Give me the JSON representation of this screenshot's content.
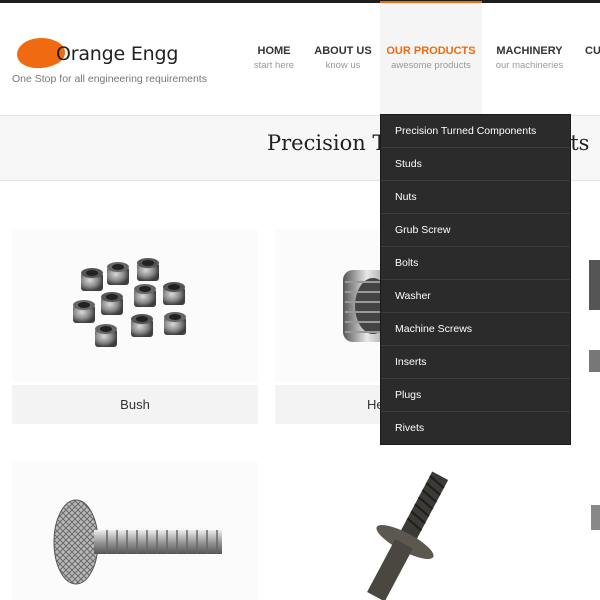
{
  "brand": {
    "name": "Orange Engg",
    "tagline": "One Stop for all engineering requirements",
    "accent": "#ef6a10"
  },
  "nav": [
    {
      "title": "HOME",
      "subtitle": "start here"
    },
    {
      "title": "ABOUT US",
      "subtitle": "know us"
    },
    {
      "title": "OUR PRODUCTS",
      "subtitle": "awesome products",
      "active": true
    },
    {
      "title": "MACHINERY",
      "subtitle": "our machineries"
    },
    {
      "title": "CU",
      "subtitle": ""
    }
  ],
  "page": {
    "title": "Precision Turned Components"
  },
  "products": [
    {
      "label": "Bush"
    },
    {
      "label": "Hex Nut"
    }
  ],
  "dropdown": [
    "Precision Turned Components",
    "Studs",
    "Nuts",
    "Grub Screw",
    "Bolts",
    "Washer",
    "Machine Screws",
    "Inserts",
    "Plugs",
    "Rivets"
  ]
}
